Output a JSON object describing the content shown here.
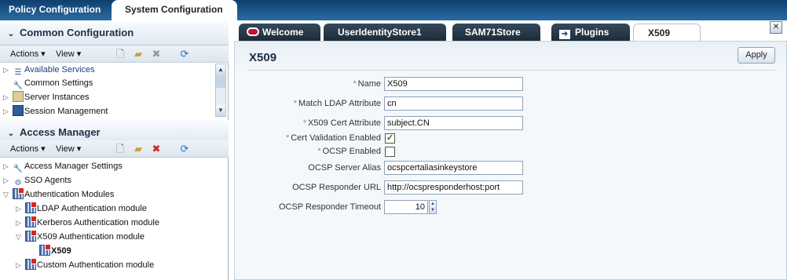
{
  "top_tabs": [
    "Policy Configuration",
    "System Configuration"
  ],
  "common": {
    "title": "Common Configuration",
    "actions_label": "Actions",
    "view_label": "View",
    "items": [
      "Available Services",
      "Common Settings",
      "Server Instances",
      "Session Management"
    ]
  },
  "access": {
    "title": "Access Manager",
    "actions_label": "Actions",
    "view_label": "View",
    "items": [
      "Access Manager Settings",
      "SSO Agents",
      "Authentication Modules",
      "LDAP Authentication module",
      "Kerberos Authentication module",
      "X509 Authentication module",
      "X509",
      "Custom Authentication module"
    ]
  },
  "panel_tabs": [
    "Welcome",
    "UserIdentityStore1",
    "SAM71Store",
    "Plugins",
    "X509"
  ],
  "form": {
    "title": "X509",
    "apply_label": "Apply",
    "labels": {
      "name": "Name",
      "match_ldap": "Match LDAP Attribute",
      "cert_attr": "X509 Cert Attribute",
      "cert_validation": "Cert Validation Enabled",
      "ocsp_enabled": "OCSP Enabled",
      "ocsp_alias": "OCSP Server Alias",
      "ocsp_url": "OCSP Responder URL",
      "ocsp_timeout": "OCSP Responder Timeout"
    },
    "required_mark": "*",
    "values": {
      "name": "X509",
      "match_ldap": "cn",
      "cert_attr": "subject.CN",
      "ocsp_alias": "ocspcertaliasinkeystore",
      "ocsp_url": "http://ocspresponderhost:port",
      "ocsp_timeout": "10"
    },
    "cert_validation_checked": true,
    "ocsp_enabled_checked": false
  },
  "icons": {
    "accent_red": "#d22222",
    "welcome_logo": "oracle-logo-icon",
    "plugins": "plugin-arrow-icon"
  }
}
